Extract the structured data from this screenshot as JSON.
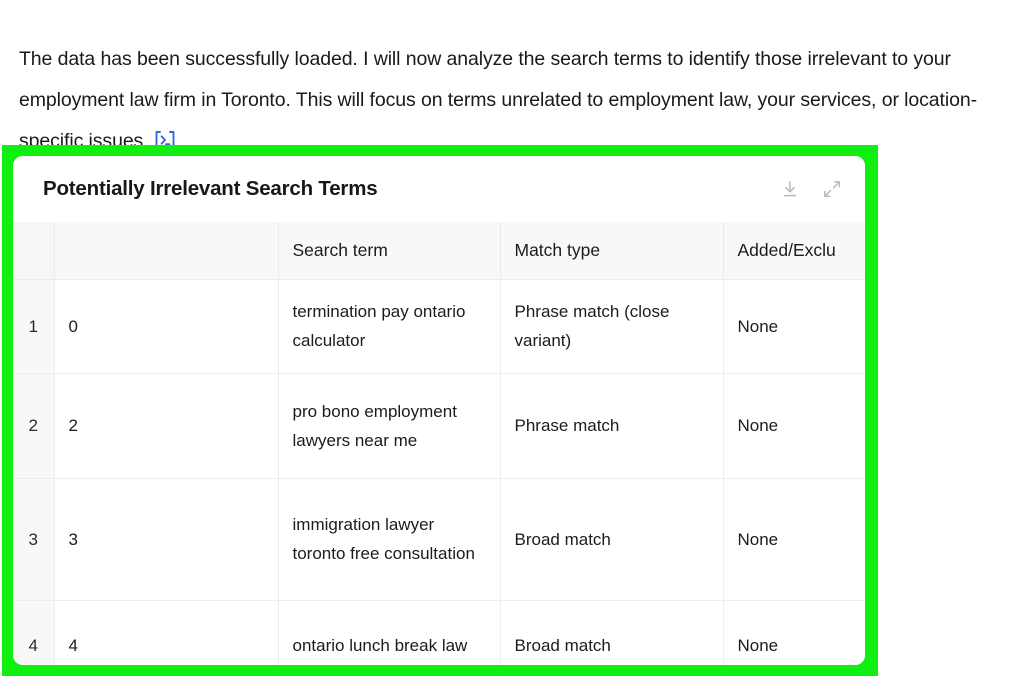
{
  "intro": {
    "text": "The data has been successfully loaded. I will now analyze the search terms to identify those irrelevant to your employment law firm in Toronto. This will focus on terms unrelated to employment law, your services, or location-specific issues.",
    "trailing_icon": "terminal-icon",
    "icon_color": "#2d6cdf",
    "text_color": "#1a1a1a"
  },
  "highlight": {
    "border_color": "#11ef11",
    "name": "green-highlight-frame"
  },
  "card": {
    "title": "Potentially Irrelevant Search Terms",
    "actions": [
      {
        "name": "download-icon",
        "label": "Download"
      },
      {
        "name": "expand-icon",
        "label": "Expand"
      }
    ]
  },
  "table": {
    "columns": [
      {
        "key": "index",
        "label": ""
      },
      {
        "key": "rowid",
        "label": ""
      },
      {
        "key": "search_term",
        "label": "Search term"
      },
      {
        "key": "match_type",
        "label": "Match type"
      },
      {
        "key": "added_excluded",
        "label": "Added/Exclu"
      }
    ],
    "rows": [
      {
        "index": "1",
        "rowid": "0",
        "search_term": "termination pay ontario calculator",
        "match_type": "Phrase match (close variant)",
        "added_excluded": "None"
      },
      {
        "index": "2",
        "rowid": "2",
        "search_term": "pro bono employment lawyers near me",
        "match_type": "Phrase match",
        "added_excluded": "None"
      },
      {
        "index": "3",
        "rowid": "3",
        "search_term": "immigration lawyer toronto free consultation",
        "match_type": "Broad match",
        "added_excluded": "None"
      },
      {
        "index": "4",
        "rowid": "4",
        "search_term": "ontario lunch break law",
        "match_type": "Broad match",
        "added_excluded": "None"
      }
    ]
  }
}
